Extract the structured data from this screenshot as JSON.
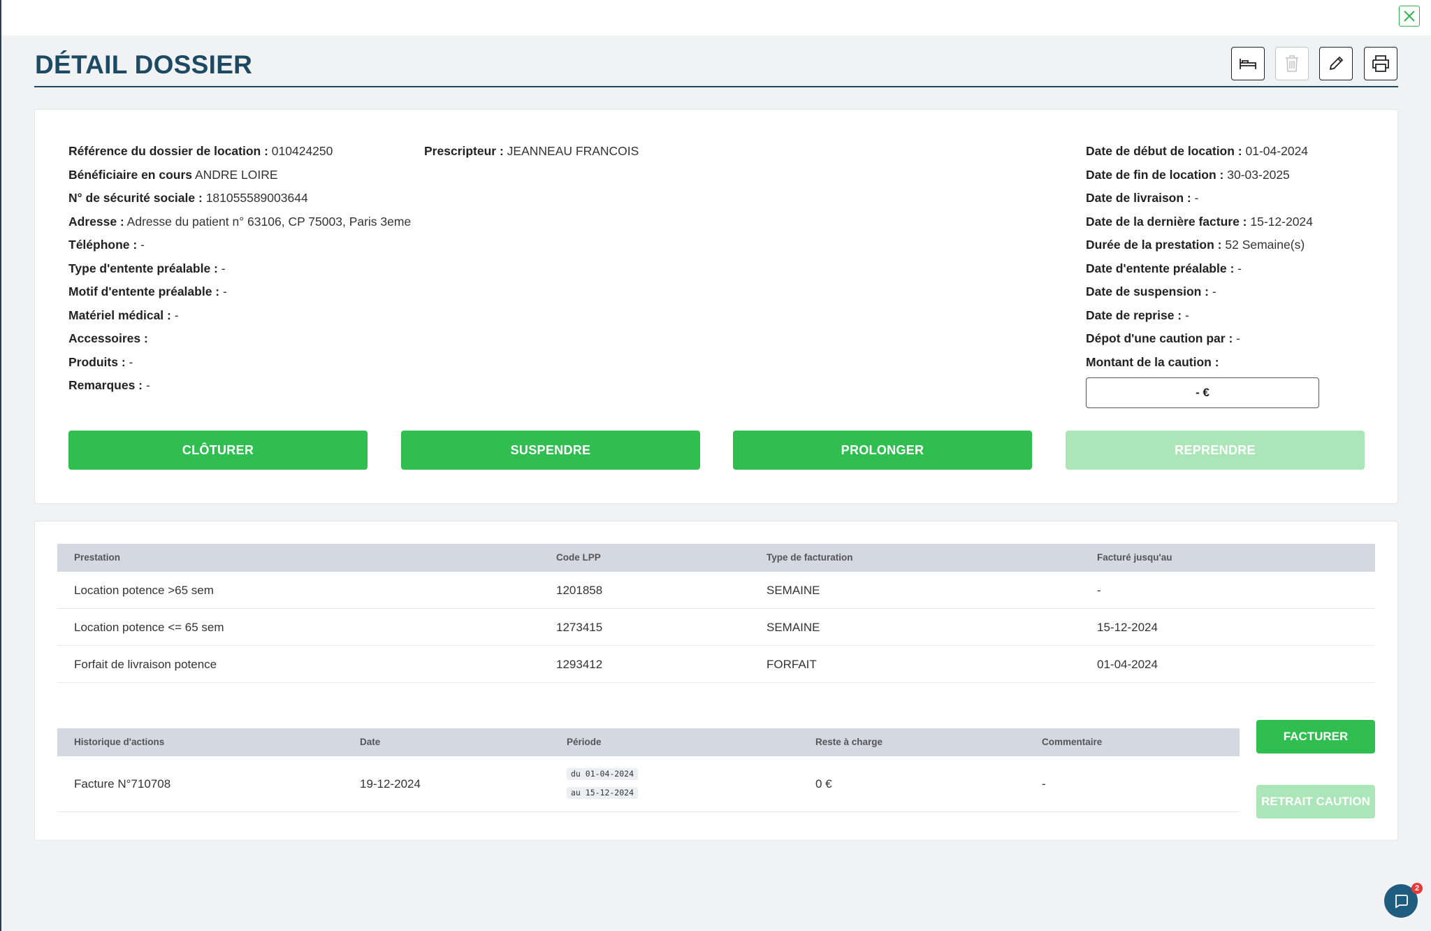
{
  "page": {
    "title": "DÉTAIL DOSSIER",
    "icons": {
      "close": "close-icon",
      "toolbar": [
        "bed-icon",
        "trash-icon",
        "pencil-icon",
        "printer-icon"
      ],
      "chat": "chat-icon"
    },
    "colors": {
      "primary": "#2fbe4f",
      "primary_disabled": "#aae6b7",
      "title": "#1c4a63",
      "header_bg": "#d4d8e0"
    }
  },
  "dossier": {
    "left": [
      {
        "label": "Référence du dossier de location :",
        "value": "010424250"
      },
      {
        "label": "Bénéficiaire en cours",
        "value": "ANDRE LOIRE"
      },
      {
        "label": "N° de sécurité sociale :",
        "value": "181055589003644"
      },
      {
        "label": "Adresse :",
        "value": "Adresse du patient n° 63106, CP 75003, Paris 3eme"
      },
      {
        "label": "Téléphone :",
        "value": "-"
      },
      {
        "label": "Type d'entente préalable :",
        "value": "-"
      },
      {
        "label": "Motif d'entente préalable :",
        "value": "-"
      },
      {
        "label": "Matériel médical :",
        "value": "-"
      },
      {
        "label": "Accessoires :",
        "value": ""
      },
      {
        "label": "Produits :",
        "value": "-"
      },
      {
        "label": "Remarques :",
        "value": "-"
      }
    ],
    "prescripteur": {
      "label": "Prescripteur :",
      "value": "JEANNEAU FRANCOIS"
    },
    "right": [
      {
        "label": "Date de début de location :",
        "value": "01-04-2024"
      },
      {
        "label": "Date de fin de location :",
        "value": "30-03-2025"
      },
      {
        "label": "Date de livraison :",
        "value": "-"
      },
      {
        "label": "Date de la dernière facture :",
        "value": "15-12-2024"
      },
      {
        "label": "Durée de la prestation :",
        "value": "52 Semaine(s)"
      },
      {
        "label": "Date d'entente préalable :",
        "value": "-"
      },
      {
        "label": "Date de suspension :",
        "value": "-"
      },
      {
        "label": "Date de reprise :",
        "value": "-"
      },
      {
        "label": "Dépot d'une caution par :",
        "value": "-"
      },
      {
        "label": "Montant de la caution :",
        "value": ""
      }
    ],
    "caution_amount": "- €"
  },
  "actions": {
    "cloturer": "CLÔTURER",
    "suspendre": "SUSPENDRE",
    "prolonger": "PROLONGER",
    "reprendre": "REPRENDRE"
  },
  "prestations": {
    "headers": [
      "Prestation",
      "Code LPP",
      "Type de facturation",
      "Facturé jusqu'au"
    ],
    "rows": [
      [
        "Location potence >65 sem",
        "1201858",
        "SEMAINE",
        "-"
      ],
      [
        "Location potence <= 65 sem",
        "1273415",
        "SEMAINE",
        "15-12-2024"
      ],
      [
        "Forfait de livraison potence",
        "1293412",
        "FORFAIT",
        "01-04-2024"
      ]
    ]
  },
  "historique": {
    "headers": [
      "Historique d'actions",
      "Date",
      "Période",
      "Reste à charge",
      "Commentaire"
    ],
    "rows": [
      {
        "action": "Facture N°710708",
        "date": "19-12-2024",
        "period_from": "du 01-04-2024",
        "period_to": "au 15-12-2024",
        "reste": "0 €",
        "commentaire": "-"
      }
    ],
    "facturer": "FACTURER",
    "retrait_caution": "RETRAIT CAUTION"
  },
  "chat": {
    "badge": "2"
  }
}
